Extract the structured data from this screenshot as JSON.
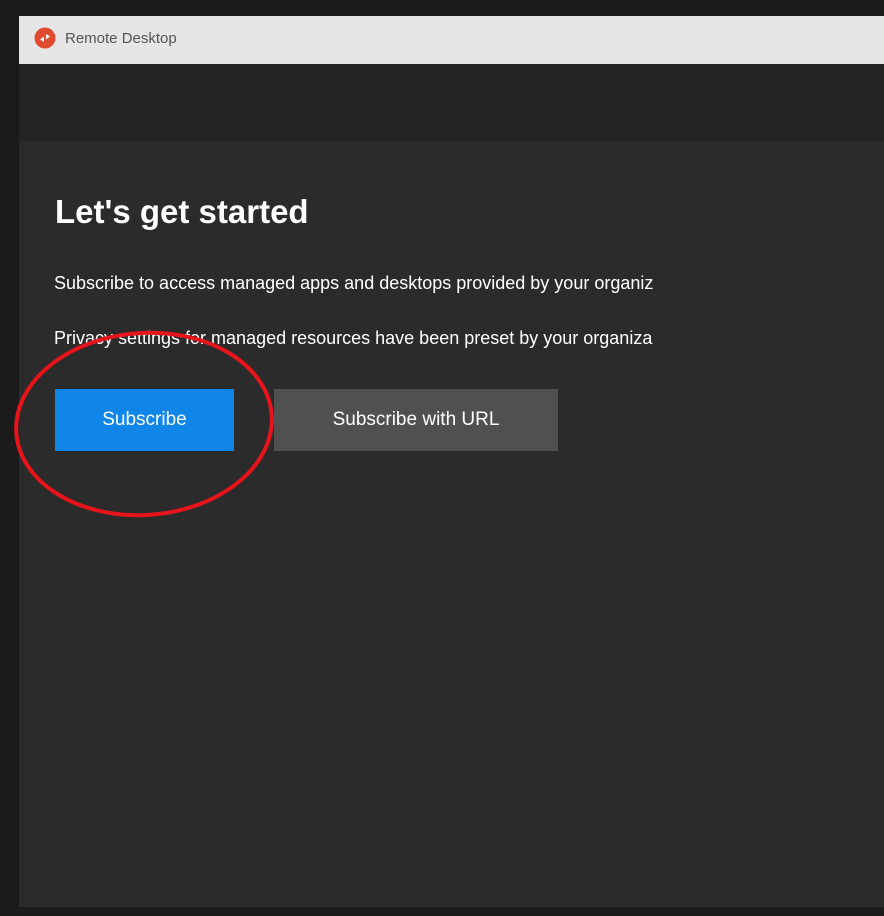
{
  "window": {
    "title": "Remote Desktop",
    "app_icon": "remote-desktop-icon"
  },
  "main": {
    "heading": "Let's get started",
    "description_1": "Subscribe to access managed apps and desktops provided by your organiz",
    "description_2": "Privacy settings for managed resources have been preset by your organiza",
    "subscribe_label": "Subscribe",
    "subscribe_url_label": "Subscribe with URL"
  },
  "colors": {
    "accent": "#0f86e8",
    "secondary_button": "#505050",
    "background": "#2b2b2b",
    "annotation": "#e8141b"
  }
}
